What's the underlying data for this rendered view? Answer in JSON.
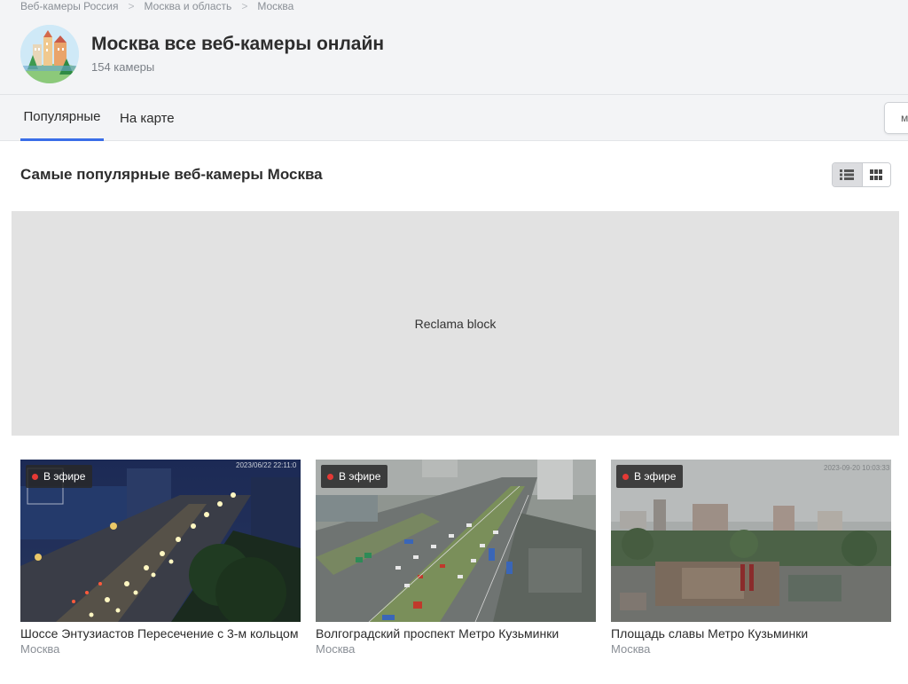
{
  "breadcrumb": [
    "Веб-камеры Россия",
    "Москва и область",
    "Москва"
  ],
  "header": {
    "title": "Москва все веб-камеры онлайн",
    "count": "154 камеры"
  },
  "tabs": [
    {
      "label": "Популярные",
      "active": true
    },
    {
      "label": "На карте",
      "active": false
    }
  ],
  "right_button_label": "м",
  "section": {
    "title": "Самые популярные веб-камеры Москва",
    "view_modes": [
      "list-icon",
      "grid-icon"
    ],
    "active_view": "list"
  },
  "ad": {
    "label": "Reclama block"
  },
  "cameras": [
    {
      "badge": "В эфире",
      "title": "Шоссе Энтузиастов Пересечение с 3-м кольцом",
      "city": "Москва",
      "timestamp": "2023/06/22 22:11:0"
    },
    {
      "badge": "В эфире",
      "title": "Волгоградский проспект Метро Кузьминки",
      "city": "Москва",
      "timestamp": ""
    },
    {
      "badge": "В эфире",
      "title": "Площадь славы Метро Кузьминки",
      "city": "Москва",
      "timestamp": "2023-09-20 10:03:33"
    }
  ],
  "colors": {
    "accent": "#3a6ee8",
    "live": "#e53935",
    "header_bg": "#f3f4f6",
    "ad_bg": "#e2e2e2"
  }
}
